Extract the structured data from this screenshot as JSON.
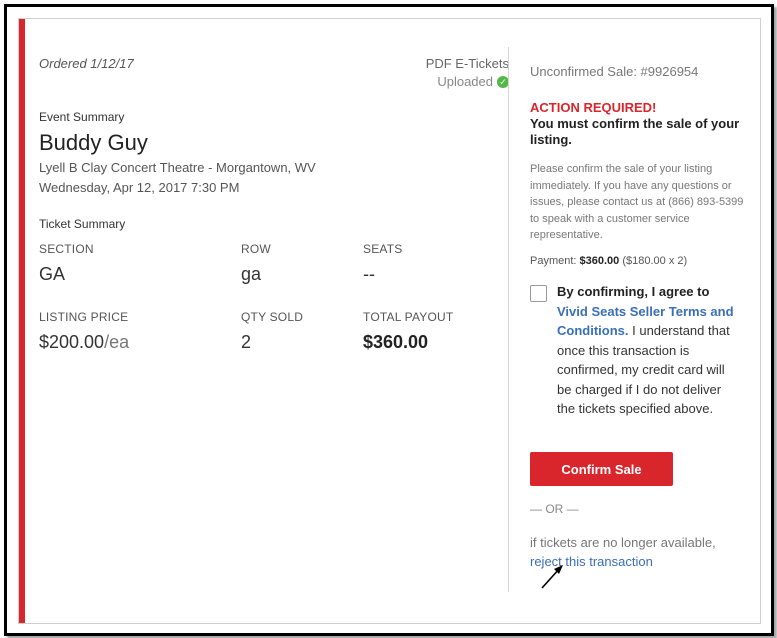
{
  "order": {
    "ordered_label": "Ordered 1/12/17",
    "ticket_type": "PDF E-Tickets",
    "uploaded_label": "Uploaded",
    "uploaded_icon": "check-circle-icon",
    "uploaded_color": "#54b848"
  },
  "event_summary": {
    "heading": "Event Summary",
    "event_name": "Buddy Guy",
    "venue": "Lyell B Clay Concert Theatre - Morgantown, WV",
    "date": "Wednesday, Apr 12, 2017 7:30 PM"
  },
  "ticket_summary": {
    "heading": "Ticket Summary",
    "section_label": "SECTION",
    "section_value": "GA",
    "row_label": "ROW",
    "row_value": "ga",
    "seats_label": "SEATS",
    "seats_value": "--",
    "listing_price_label": "LISTING PRICE",
    "listing_price_value": "$200.00",
    "listing_price_unit": "/ea",
    "qty_sold_label": "QTY SOLD",
    "qty_sold_value": "2",
    "total_payout_label": "TOTAL PAYOUT",
    "total_payout_value": "$360.00"
  },
  "sidebar": {
    "unconfirmed": "Unconfirmed Sale: #9926954",
    "action_required": "ACTION REQUIRED!",
    "must_confirm": "You must confirm the sale of your listing.",
    "instructions": "Please confirm the sale of your listing immediately. If you have any questions or issues, please contact us at (866) 893-5399 to speak with a customer service representative.",
    "payment_label": "Payment:",
    "payment_amount": "$360.00",
    "payment_breakdown": "($180.00 x 2)",
    "agree_bold": "By confirming, I agree to",
    "terms_link": "Vivid Seats Seller Terms and Conditions.",
    "agree_rest": " I understand that once this transaction is confirmed, my credit card will be charged if I do not deliver the tickets specified above.",
    "confirm_button": "Confirm Sale",
    "or_separator": "— OR —",
    "no_longer_available": "if tickets are no longer available,",
    "reject_link": "reject this transaction"
  },
  "colors": {
    "accent": "#d9262c",
    "link": "#3a6fb7"
  }
}
